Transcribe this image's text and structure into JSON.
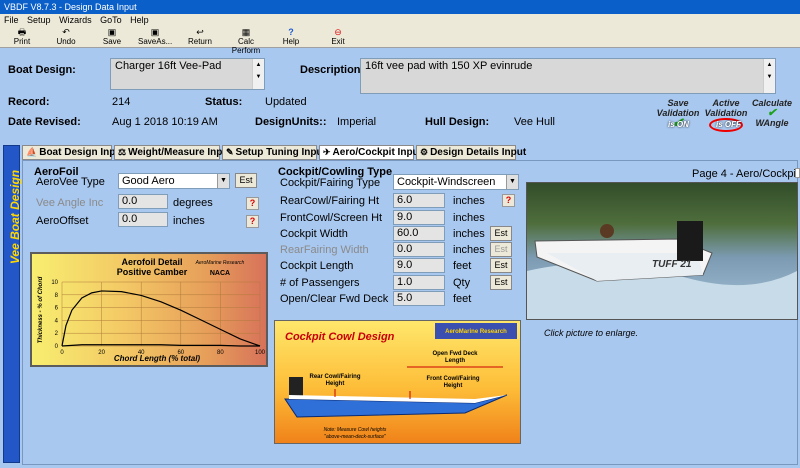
{
  "window": {
    "title": "VBDF V8.7.3 - Design Data Input"
  },
  "menu": [
    "File",
    "Setup",
    "Wizards",
    "GoTo",
    "Help"
  ],
  "toolbar": {
    "print": "Print",
    "undo": "Undo",
    "save": "Save",
    "saveas": "SaveAs...",
    "return": "Return",
    "calc": "Calc Perform",
    "help": "Help",
    "exit": "Exit"
  },
  "header": {
    "boat_design_label": "Boat Design:",
    "boat_design_value": "Charger 16ft Vee-Pad",
    "description_label": "Description:",
    "description_value": "16ft vee pad with 150 XP evinrude",
    "record_label": "Record:",
    "record_value": "214",
    "status_label": "Status:",
    "status_value": "Updated",
    "date_label": "Date Revised:",
    "date_value": "Aug 1 2018 10:19 AM",
    "units_label": "DesignUnits::",
    "units_value": "Imperial",
    "hull_label": "Hull Design:",
    "hull_value": "Vee Hull"
  },
  "badges": {
    "save_validation_line1": "Save",
    "save_validation_line2": "Validation",
    "save_validation_state": "is ON",
    "active_validation_line1": "Active",
    "active_validation_line2": "Validation",
    "active_validation_state": "is OFF",
    "calculate_line1": "Calculate",
    "calculate_line2": "WAngle"
  },
  "side_band": "Vee Boat Design",
  "tabs": [
    "Boat Design Input",
    "Weight/Measure Input",
    "Setup Tuning Input",
    "Aero/Cockpit Input",
    "Design Details Input"
  ],
  "page_label": "Page 4 - Aero/Cockpit",
  "aerofoil": {
    "section_title": "AeroFoil",
    "type_label": "AeroVee Type",
    "type_value": "Good Aero",
    "angle_label": "Vee Angle Inc",
    "angle_value": "0.0",
    "angle_unit": "degrees",
    "offset_label": "AeroOffset",
    "offset_value": "0.0",
    "offset_unit": "inches",
    "est": "Est",
    "help": "?"
  },
  "cockpit": {
    "section_title": "Cockpit/Cowling Type",
    "type_label": "Cockpit/Fairing Type",
    "type_value": "Cockpit-Windscreen",
    "rows": [
      {
        "label": "RearCowl/Fairing Ht",
        "value": "6.0",
        "unit": "inches",
        "btn": "?"
      },
      {
        "label": "FrontCowl/Screen Ht",
        "value": "9.0",
        "unit": "inches",
        "btn": ""
      },
      {
        "label": "Cockpit Width",
        "value": "60.0",
        "unit": "inches",
        "btn": "Est"
      },
      {
        "label": "RearFairing Width",
        "value": "0.0",
        "unit": "inches",
        "btn": "Est"
      },
      {
        "label": "Cockpit Length",
        "value": "9.0",
        "unit": "feet",
        "btn": "Est"
      },
      {
        "label": "# of Passengers",
        "value": "1.0",
        "unit": "Qty",
        "btn": "Est"
      },
      {
        "label": "Open/Clear Fwd Deck",
        "value": "5.0",
        "unit": "feet",
        "btn": ""
      }
    ]
  },
  "aerofoil_chart": {
    "title_line1": "Aerofoil Detail",
    "title_line2": "Positive Camber",
    "brand": "AeroMarine Research",
    "badge": "NACA",
    "xlabel": "Chord Length (% total)",
    "ylabel": "Thickness - % of Chord",
    "xticks": [
      "0",
      "20",
      "40",
      "60",
      "80",
      "100"
    ],
    "yticks": [
      "10",
      "8",
      "6",
      "4",
      "2",
      "0"
    ]
  },
  "chart_data": {
    "type": "line",
    "title": "Aerofoil Detail Positive Camber",
    "xlabel": "Chord Length (% total)",
    "ylabel": "Thickness - % of Chord",
    "xlim": [
      0,
      100
    ],
    "ylim": [
      0,
      10
    ],
    "series": [
      {
        "x": [
          0,
          2,
          5,
          10,
          15,
          20,
          30,
          40,
          50,
          60,
          70,
          80,
          90,
          100
        ],
        "y": [
          0,
          3.2,
          5.6,
          7.5,
          8.3,
          8.6,
          8.5,
          7.9,
          6.9,
          5.6,
          4.1,
          2.6,
          1.1,
          0
        ]
      },
      {
        "x": [
          0,
          10,
          20,
          30,
          40,
          50,
          60,
          70,
          80,
          90,
          100
        ],
        "y": [
          0,
          0.2,
          0.2,
          0.2,
          0.2,
          0.2,
          0.1,
          0.1,
          0.1,
          0,
          0
        ]
      }
    ],
    "grid": true
  },
  "cowl_diagram": {
    "title": "Cockpit Cowl Design",
    "brand": "AeroMarine Research",
    "rear_label_1": "Rear Cowl/Fairing",
    "rear_label_2": "Height",
    "open_label_1": "Open Fwd Deck",
    "open_label_2": "Length",
    "front_label_1": "Front Cowl/Fairing",
    "front_label_2": "Height",
    "note_1": "Note: Measure Cowl heights",
    "note_2": "\"above-mean-deck-surface\""
  },
  "photo": {
    "hull_text": "TUFF 21",
    "caption": "Click picture to enlarge."
  }
}
